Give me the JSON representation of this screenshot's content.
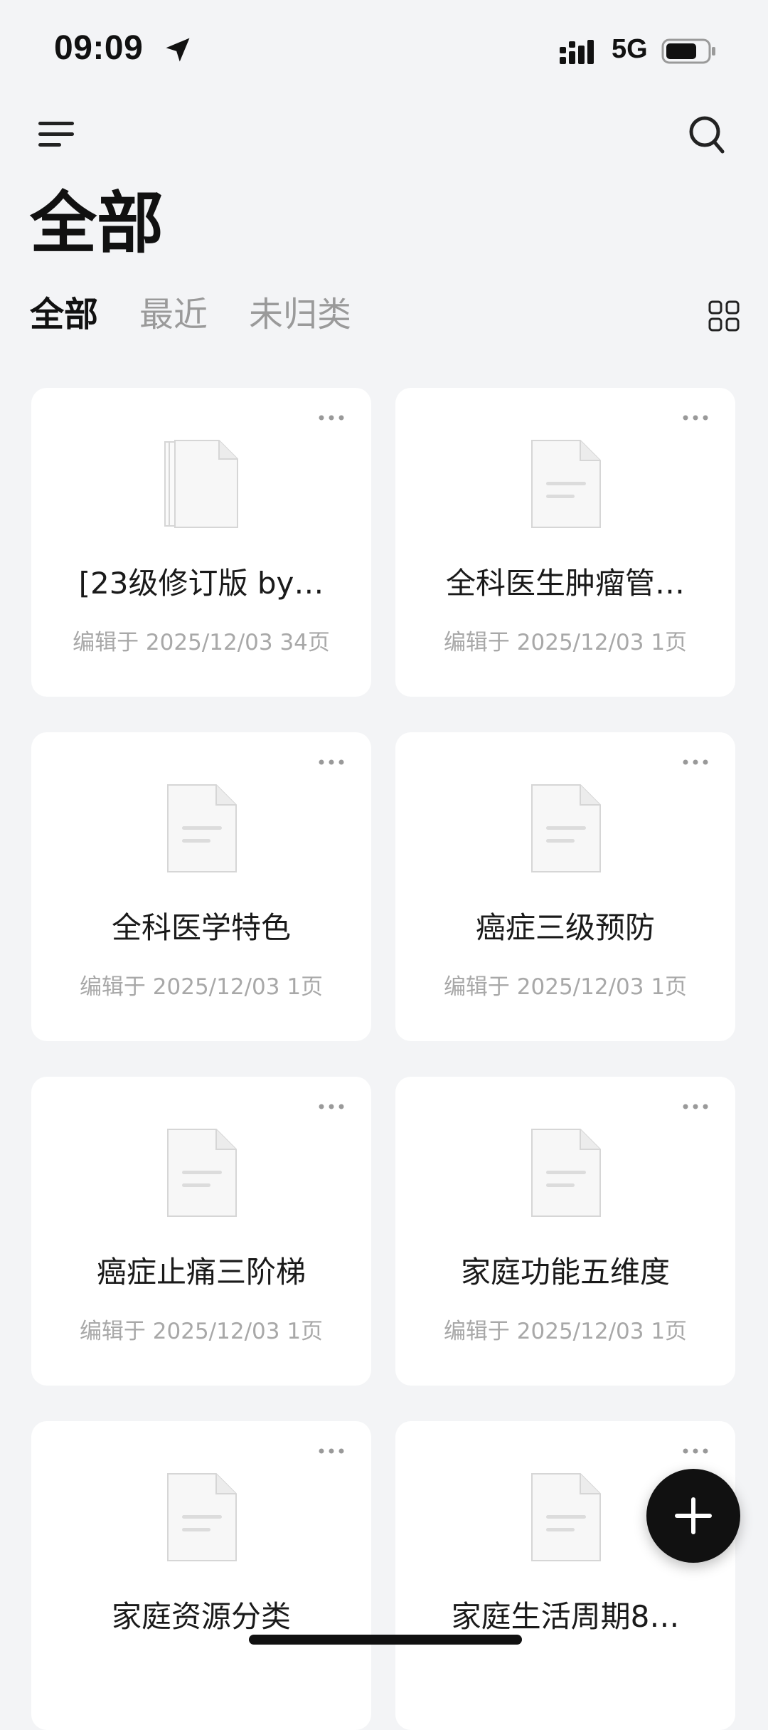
{
  "status_bar": {
    "time": "09:09",
    "network": "5G"
  },
  "header": {
    "title": "全部"
  },
  "tabs": [
    {
      "label": "全部",
      "active": true
    },
    {
      "label": "最近",
      "active": false
    },
    {
      "label": "未归类",
      "active": false
    }
  ],
  "documents": [
    {
      "title": "[23级修订版 by…",
      "meta": "编辑于 2025/12/03 34页",
      "icon": "stacked-pages-icon"
    },
    {
      "title": "全科医生肿瘤管…",
      "meta": "编辑于 2025/12/03 1页",
      "icon": "document-icon"
    },
    {
      "title": "全科医学特色",
      "meta": "编辑于 2025/12/03 1页",
      "icon": "document-icon"
    },
    {
      "title": "癌症三级预防",
      "meta": "编辑于 2025/12/03 1页",
      "icon": "document-icon"
    },
    {
      "title": "癌症止痛三阶梯",
      "meta": "编辑于 2025/12/03 1页",
      "icon": "document-icon"
    },
    {
      "title": "家庭功能五维度",
      "meta": "编辑于 2025/12/03 1页",
      "icon": "document-icon"
    },
    {
      "title": "家庭资源分类",
      "meta": "",
      "icon": "document-icon"
    },
    {
      "title": "家庭生活周期8…",
      "meta": "",
      "icon": "document-icon"
    }
  ],
  "colors": {
    "background": "#f3f4f6",
    "card": "#ffffff",
    "text_primary": "#111111",
    "text_secondary": "#a8a8a8",
    "fab": "#111111"
  }
}
